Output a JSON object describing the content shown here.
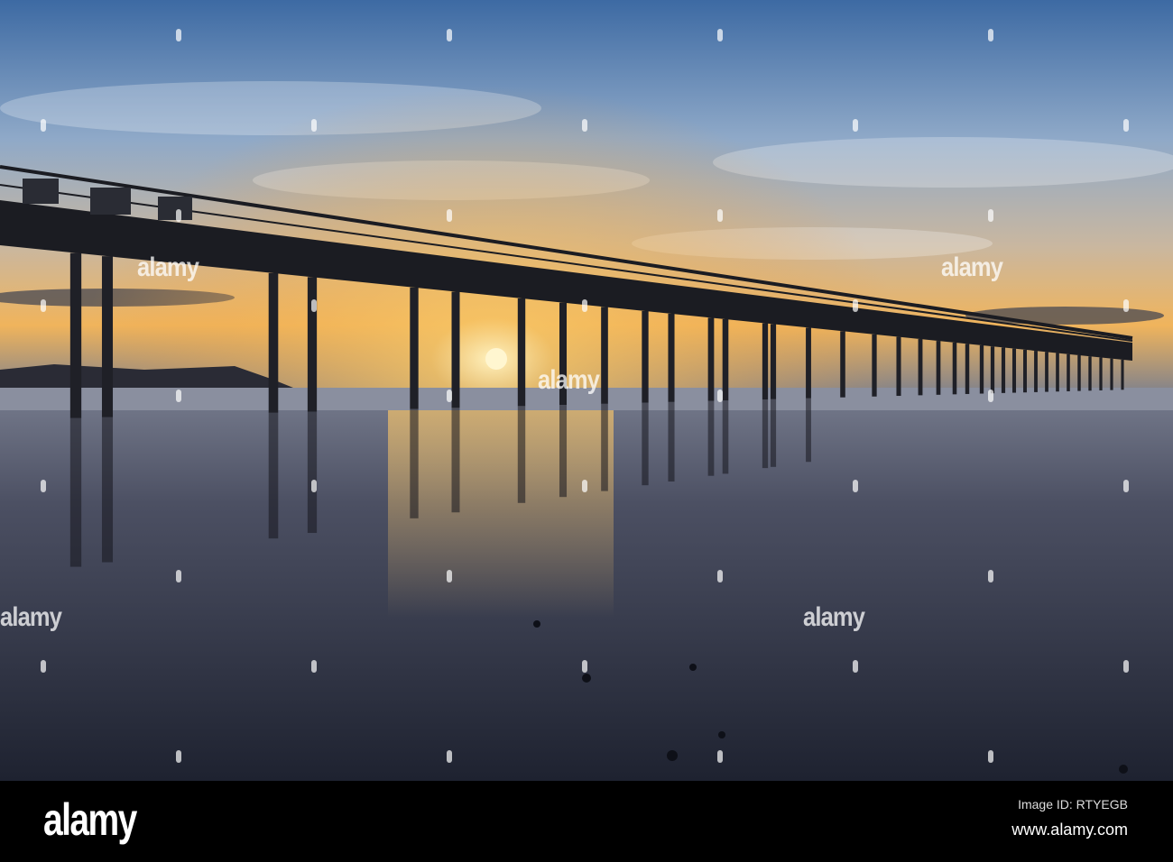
{
  "photo": {
    "subject": "pier-at-sunset",
    "colors": {
      "sky_top": "#3f6fa8",
      "sky_mid": "#9fb6cf",
      "horizon": "#f2b45a",
      "sun": "#fff3c4",
      "sand": "#2a2f3e",
      "pier": "#1b1c22"
    }
  },
  "watermark": {
    "text": "alamy"
  },
  "banner": {
    "brand": "alamy",
    "image_id": "Image ID: RTYEGB",
    "website": "www.alamy.com"
  }
}
